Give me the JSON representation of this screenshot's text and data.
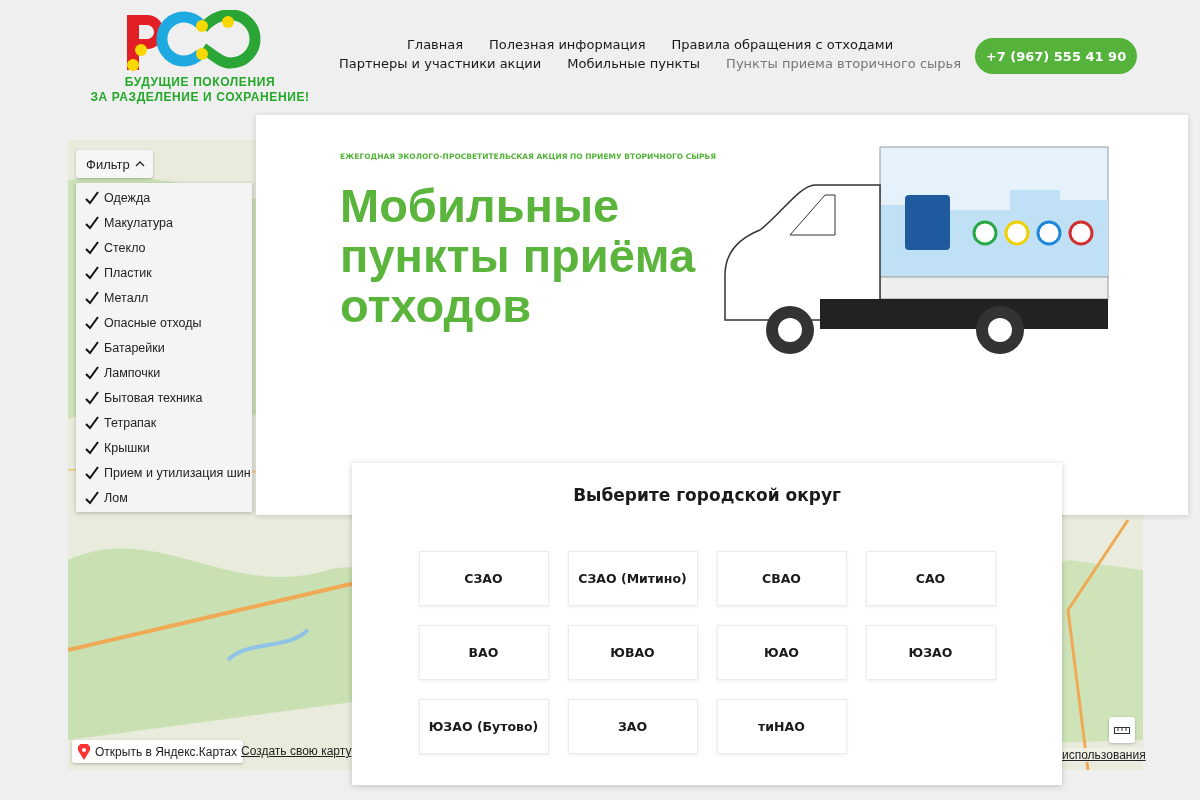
{
  "logo": {
    "lines": [
      "БУДУЩИЕ ПОКОЛЕНИЯ",
      "ЗА РАЗДЕЛЕНИЕ И СОХРАНЕНИЕ!"
    ]
  },
  "nav": {
    "rows": [
      [
        {
          "label": "Главная",
          "selected": false
        },
        {
          "label": "Полезная информация",
          "selected": false
        },
        {
          "label": "Правила обращения с отходами",
          "selected": false
        }
      ],
      [
        {
          "label": "Партнеры и участники акции",
          "selected": false
        },
        {
          "label": "Мобильные пункты",
          "selected": false
        },
        {
          "label": "Пункты приема вторичного сырья",
          "selected": true
        }
      ]
    ]
  },
  "phone": "+7 (967) 555 41 90",
  "map": {
    "kind": "picture",
    "filter": {
      "label": "Фильтр",
      "expanded": true,
      "items": [
        {
          "label": "Одежда",
          "checked": true
        },
        {
          "label": "Макулатура",
          "checked": true
        },
        {
          "label": "Стекло",
          "checked": true
        },
        {
          "label": "Пластик",
          "checked": true
        },
        {
          "label": "Металл",
          "checked": true
        },
        {
          "label": "Опасные отходы",
          "checked": true
        },
        {
          "label": "Батарейки",
          "checked": true
        },
        {
          "label": "Лампочки",
          "checked": true
        },
        {
          "label": "Бытовая техника",
          "checked": true
        },
        {
          "label": "Тетрапак",
          "checked": true
        },
        {
          "label": "Крышки",
          "checked": true
        },
        {
          "label": "Прием и утилизация шин",
          "checked": true
        },
        {
          "label": "Лом",
          "checked": true
        }
      ]
    },
    "open_button": "Открыть в Яндекс.Картах",
    "create_link": "Создать свою карту",
    "terms_link": "использования"
  },
  "hero": {
    "tagline": "ЕЖЕГОДНАЯ ЭКОЛОГО-ПРОСВЕТИТЕЛЬСКАЯ АКЦИЯ ПО ПРИЕМУ ВТОРИЧНОГО СЫРЬЯ",
    "title": "Мобильные пункты приёма отходов"
  },
  "districts": {
    "title": "Выберите городской округ",
    "items": [
      "СЗАО",
      "СЗАО (Митино)",
      "СВАО",
      "САО",
      "ВАО",
      "ЮВАО",
      "ЮАО",
      "ЮЗАО",
      "ЮЗАО (Бутово)",
      "ЗАО",
      "тиНАО"
    ]
  }
}
